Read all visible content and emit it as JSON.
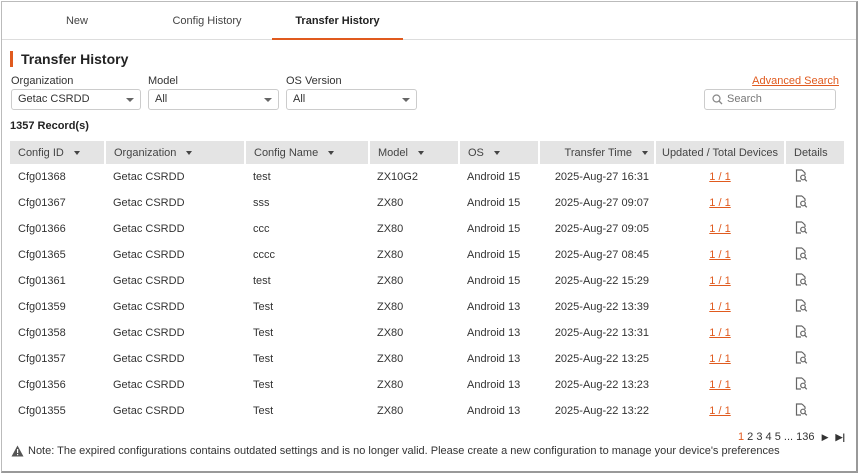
{
  "tabs": [
    "New",
    "Config History",
    "Transfer History"
  ],
  "title": "Transfer History",
  "filters": {
    "organization": {
      "label": "Organization",
      "value": "Getac CSRDD"
    },
    "model": {
      "label": "Model",
      "value": "All"
    },
    "os": {
      "label": "OS Version",
      "value": "All"
    }
  },
  "advanced_search": "Advanced Search",
  "search_placeholder": "Search",
  "records": "1357 Record(s)",
  "columns": [
    "Config ID",
    "Organization",
    "Config Name",
    "Model",
    "OS",
    "Transfer Time",
    "Updated / Total Devices",
    "Details"
  ],
  "rows": [
    [
      "Cfg01368",
      "Getac CSRDD",
      "test",
      "ZX10G2",
      "Android 15",
      "2025-Aug-27 16:31",
      "1 / 1"
    ],
    [
      "Cfg01367",
      "Getac CSRDD",
      "sss",
      "ZX80",
      "Android 15",
      "2025-Aug-27 09:07",
      "1 / 1"
    ],
    [
      "Cfg01366",
      "Getac CSRDD",
      "ccc",
      "ZX80",
      "Android 15",
      "2025-Aug-27 09:05",
      "1 / 1"
    ],
    [
      "Cfg01365",
      "Getac CSRDD",
      "cccc",
      "ZX80",
      "Android 15",
      "2025-Aug-27 08:45",
      "1 / 1"
    ],
    [
      "Cfg01361",
      "Getac CSRDD",
      "test",
      "ZX80",
      "Android 15",
      "2025-Aug-22 15:29",
      "1 / 1"
    ],
    [
      "Cfg01359",
      "Getac CSRDD",
      "Test",
      "ZX80",
      "Android 13",
      "2025-Aug-22 13:39",
      "1 / 1"
    ],
    [
      "Cfg01358",
      "Getac CSRDD",
      "Test",
      "ZX80",
      "Android 13",
      "2025-Aug-22 13:31",
      "1 / 1"
    ],
    [
      "Cfg01357",
      "Getac CSRDD",
      "Test",
      "ZX80",
      "Android 13",
      "2025-Aug-22 13:25",
      "1 / 1"
    ],
    [
      "Cfg01356",
      "Getac CSRDD",
      "Test",
      "ZX80",
      "Android 13",
      "2025-Aug-22 13:23",
      "1 / 1"
    ],
    [
      "Cfg01355",
      "Getac CSRDD",
      "Test",
      "ZX80",
      "Android 13",
      "2025-Aug-22 13:22",
      "1 / 1"
    ]
  ],
  "pagination": {
    "pages": [
      "1",
      "2",
      "3",
      "4",
      "5"
    ],
    "ellipsis": "...",
    "last": "136",
    "current": "1"
  },
  "note": "Note: The expired configurations contains outdated settings and is no longer valid. Please create a new configuration to manage your device's preferences"
}
